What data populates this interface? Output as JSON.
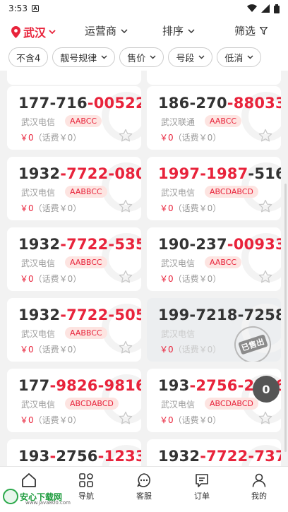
{
  "status_bar": {
    "time": "3:53",
    "a_icon": "A"
  },
  "top_bar": {
    "city": "武汉",
    "menus": [
      {
        "label": "运营商"
      },
      {
        "label": "排序"
      },
      {
        "label": "筛选"
      }
    ]
  },
  "filters": [
    {
      "label": "不含4",
      "dropdown": false
    },
    {
      "label": "靓号规律",
      "dropdown": true
    },
    {
      "label": "售价",
      "dropdown": true
    },
    {
      "label": "号段",
      "dropdown": true
    },
    {
      "label": "低消",
      "dropdown": true
    }
  ],
  "price_suffix": "（话费￥0）",
  "cards": [
    {
      "parts": [
        [
          "177",
          "d"
        ],
        [
          "-",
          "d"
        ],
        [
          "716",
          "d"
        ],
        [
          "-",
          "s"
        ],
        [
          "00522",
          "h"
        ]
      ],
      "carrier": "武汉电信",
      "tag": "AABCC",
      "price": "￥0",
      "sold": false
    },
    {
      "parts": [
        [
          "186",
          "d"
        ],
        [
          "-",
          "d"
        ],
        [
          "270",
          "d"
        ],
        [
          "-",
          "s"
        ],
        [
          "88033",
          "h"
        ]
      ],
      "carrier": "武汉联通",
      "tag": "AABCC",
      "price": "￥0",
      "sold": false
    },
    {
      "parts": [
        [
          "1932",
          "d"
        ],
        [
          "-",
          "s"
        ],
        [
          "7722",
          "h"
        ],
        [
          "-",
          "s"
        ],
        [
          "080",
          "h"
        ]
      ],
      "carrier": "武汉电信",
      "tag": "AABBCC",
      "price": "￥0",
      "sold": false
    },
    {
      "parts": [
        [
          "1997",
          "h"
        ],
        [
          "-",
          "s"
        ],
        [
          "1987",
          "h"
        ],
        [
          "-",
          "d"
        ],
        [
          "516",
          "d"
        ]
      ],
      "carrier": "武汉电信",
      "tag": "ABCDABCD",
      "price": "￥0",
      "sold": false
    },
    {
      "parts": [
        [
          "1932",
          "d"
        ],
        [
          "-",
          "s"
        ],
        [
          "7722",
          "h"
        ],
        [
          "-",
          "s"
        ],
        [
          "535",
          "h"
        ]
      ],
      "carrier": "武汉电信",
      "tag": "AABBCC",
      "price": "￥0",
      "sold": false
    },
    {
      "parts": [
        [
          "190",
          "d"
        ],
        [
          "-",
          "d"
        ],
        [
          "237",
          "d"
        ],
        [
          "-",
          "s"
        ],
        [
          "00933",
          "h"
        ]
      ],
      "carrier": "武汉电信",
      "tag": "AABCC",
      "price": "￥0",
      "sold": false
    },
    {
      "parts": [
        [
          "1932",
          "d"
        ],
        [
          "-",
          "s"
        ],
        [
          "7722",
          "h"
        ],
        [
          "-",
          "s"
        ],
        [
          "505",
          "h"
        ]
      ],
      "carrier": "武汉电信",
      "tag": "AABBCC",
      "price": "￥0",
      "sold": false
    },
    {
      "parts": [
        [
          "199-7218-7258",
          "d"
        ]
      ],
      "carrier": "武汉电信",
      "tag": "",
      "price": "￥0",
      "sold": true,
      "stamp": "已售出"
    },
    {
      "parts": [
        [
          "177",
          "d"
        ],
        [
          "-",
          "s"
        ],
        [
          "9826",
          "h"
        ],
        [
          "-",
          "s"
        ],
        [
          "9816",
          "h"
        ]
      ],
      "carrier": "武汉电信",
      "tag": "ABCDABCD",
      "price": "￥0",
      "sold": false
    },
    {
      "parts": [
        [
          "193",
          "d"
        ],
        [
          "-",
          "s"
        ],
        [
          "2756",
          "h"
        ],
        [
          "-",
          "s"
        ],
        [
          "2356",
          "h"
        ]
      ],
      "carrier": "武汉电信",
      "tag": "ABCDABCD",
      "price": "￥0",
      "sold": false
    },
    {
      "parts": [
        [
          "193",
          "d"
        ],
        [
          "-",
          "s"
        ],
        [
          "2756",
          "d"
        ],
        [
          "-",
          "s"
        ],
        [
          "1233",
          "h"
        ]
      ],
      "carrier": "",
      "tag": "",
      "price": "",
      "sold": false
    },
    {
      "parts": [
        [
          "1932",
          "d"
        ],
        [
          "-",
          "s"
        ],
        [
          "7722",
          "h"
        ],
        [
          "-",
          "s"
        ],
        [
          "737",
          "h"
        ]
      ],
      "carrier": "",
      "tag": "",
      "price": "",
      "sold": false
    }
  ],
  "float_button": "0",
  "bottom_nav": [
    {
      "label": "",
      "icon": "home-icon"
    },
    {
      "label": "导航",
      "icon": "grid-icon"
    },
    {
      "label": "客服",
      "icon": "chat-icon"
    },
    {
      "label": "订单",
      "icon": "order-icon"
    },
    {
      "label": "我的",
      "icon": "user-icon"
    }
  ],
  "watermark": {
    "title": "安心下载网",
    "url": "www.java800.com"
  }
}
